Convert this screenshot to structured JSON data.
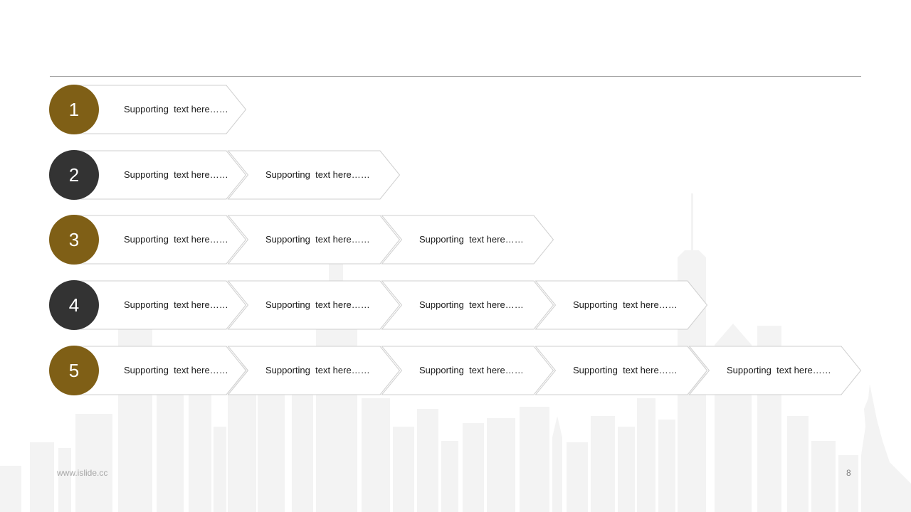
{
  "colors": {
    "gold": "#7f5f16",
    "dark": "#333333",
    "chevron_stroke": "#cfcfcf",
    "skyline": "#f2f2f2"
  },
  "rows": [
    {
      "number": "1",
      "color": "gold",
      "items": [
        "Supporting  text here……"
      ]
    },
    {
      "number": "2",
      "color": "dark",
      "items": [
        "Supporting  text here……",
        "Supporting  text here……"
      ]
    },
    {
      "number": "3",
      "color": "gold",
      "items": [
        "Supporting  text here……",
        "Supporting  text here……",
        "Supporting  text here……"
      ]
    },
    {
      "number": "4",
      "color": "dark",
      "items": [
        "Supporting  text here……",
        "Supporting  text here……",
        "Supporting  text here……",
        "Supporting  text here……"
      ]
    },
    {
      "number": "5",
      "color": "gold",
      "items": [
        "Supporting  text here……",
        "Supporting  text here……",
        "Supporting  text here……",
        "Supporting  text here……",
        "Supporting  text here……"
      ]
    }
  ],
  "footer": {
    "url": "www.islide.cc",
    "page": "8"
  }
}
